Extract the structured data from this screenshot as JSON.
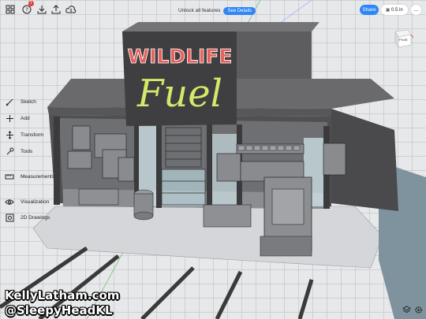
{
  "toolbar": {
    "icons": [
      "grid-icon",
      "help-icon",
      "download-icon",
      "upload-icon",
      "cloud-icon"
    ],
    "notification_count": "1",
    "unlock_text": "Unlock all features",
    "see_details_label": "See Details",
    "share_label": "Share",
    "units_label": "0.5 in",
    "more_label": "..."
  },
  "view_cube": {
    "label": "Front"
  },
  "sign": {
    "line1": "WILDLIFE",
    "line2": "Fuel",
    "colors": {
      "line1": "#e7605a",
      "line2": "#d5e86b"
    }
  },
  "left_menu": [
    {
      "label": "Sketch",
      "icon": "pencil-icon"
    },
    {
      "label": "Add",
      "icon": "plus-icon"
    },
    {
      "label": "Transform",
      "icon": "move-icon"
    },
    {
      "label": "Tools",
      "icon": "wrench-icon"
    },
    {
      "label": "Measurements",
      "icon": "ruler-icon"
    },
    {
      "label": "Visualization",
      "icon": "eye-icon"
    },
    {
      "label": "2D Drawings",
      "icon": "drawing-icon"
    }
  ],
  "watermark": {
    "line1": "KellyLatham.com",
    "line2": "@SleepyHeadKL"
  },
  "bottom_right_icons": [
    "layers-icon",
    "settings-icon"
  ],
  "colors": {
    "accent": "#2f86f6",
    "building": "#5a5a5c",
    "glass": "#d7edf2"
  }
}
